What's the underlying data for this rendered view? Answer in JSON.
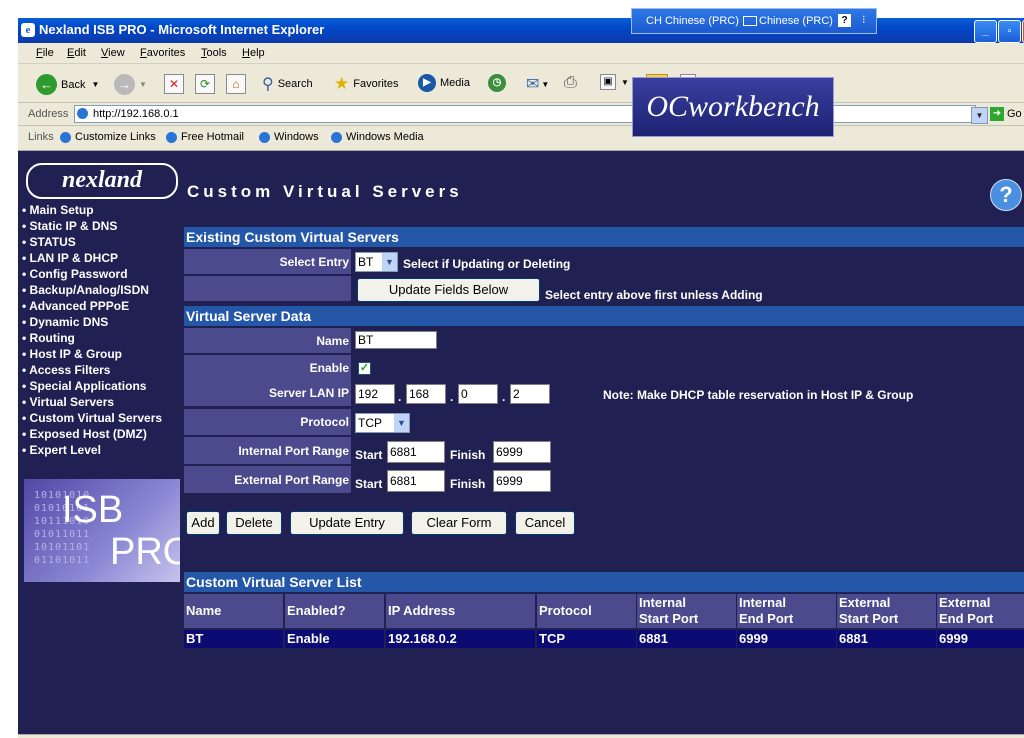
{
  "window": {
    "title": "Nexland ISB PRO - Microsoft Internet Explorer"
  },
  "langbar": {
    "lang1": "CH Chinese (PRC)",
    "lang2": "Chinese (PRC)"
  },
  "menu": [
    "File",
    "Edit",
    "View",
    "Favorites",
    "Tools",
    "Help"
  ],
  "toolbar": {
    "back": "Back",
    "search": "Search",
    "favorites": "Favorites",
    "media": "Media"
  },
  "address": {
    "label": "Address",
    "url": "http://192.168.0.1",
    "go": "Go"
  },
  "links": {
    "label": "Links",
    "items": [
      "Customize Links",
      "Free Hotmail",
      "Windows",
      "Windows Media"
    ]
  },
  "overlay": {
    "oc_logo": "OCworkbench"
  },
  "sidebar": {
    "logo": "nexland",
    "nav": [
      "Main Setup",
      "Static IP & DNS",
      "STATUS",
      "LAN IP & DHCP",
      "Config Password",
      "Backup/Analog/ISDN",
      "Advanced PPPoE",
      "Dynamic DNS",
      "Routing",
      "Host IP & Group",
      "Access Filters",
      "Special Applications",
      "Virtual Servers",
      "Custom Virtual Servers",
      "Exposed Host (DMZ)",
      "Expert Level"
    ],
    "product_logo": {
      "line1": "ISB",
      "line2": "PRO"
    }
  },
  "page": {
    "title": "Custom Virtual Servers"
  },
  "existing": {
    "heading": "Existing Custom Virtual Servers",
    "select_label": "Select Entry",
    "select_value": "BT",
    "select_hint": "Select if Updating or Deleting",
    "update_fields_btn": "Update Fields Below",
    "update_hint": "Select entry above first unless Adding"
  },
  "server_data": {
    "heading": "Virtual Server Data",
    "name_label": "Name",
    "name_value": "BT",
    "enable_label": "Enable",
    "enable_checked": true,
    "ip_label": "Server LAN IP",
    "ip": [
      "192",
      "168",
      "0",
      "2"
    ],
    "ip_sep": ".",
    "ip_note": "Note: Make DHCP table reservation in Host IP & Group",
    "protocol_label": "Protocol",
    "protocol_value": "TCP",
    "internal_label": "Internal Port Range",
    "external_label": "External Port Range",
    "start_label": "Start",
    "finish_label": "Finish",
    "internal_start": "6881",
    "internal_finish": "6999",
    "external_start": "6881",
    "external_finish": "6999"
  },
  "buttons": {
    "add": "Add",
    "delete": "Delete",
    "update_entry": "Update Entry",
    "clear_form": "Clear Form",
    "cancel": "Cancel"
  },
  "list": {
    "heading": "Custom Virtual Server List",
    "columns": [
      [
        "Name"
      ],
      [
        "Enabled?"
      ],
      [
        "IP Address"
      ],
      [
        "Protocol"
      ],
      [
        "Internal",
        "Start Port"
      ],
      [
        "Internal",
        "End Port"
      ],
      [
        "External",
        "Start Port"
      ],
      [
        "External",
        "End Port"
      ]
    ],
    "rows": [
      [
        "BT",
        "Enable",
        "192.168.0.2",
        "TCP",
        "6881",
        "6999",
        "6881",
        "6999"
      ]
    ]
  }
}
